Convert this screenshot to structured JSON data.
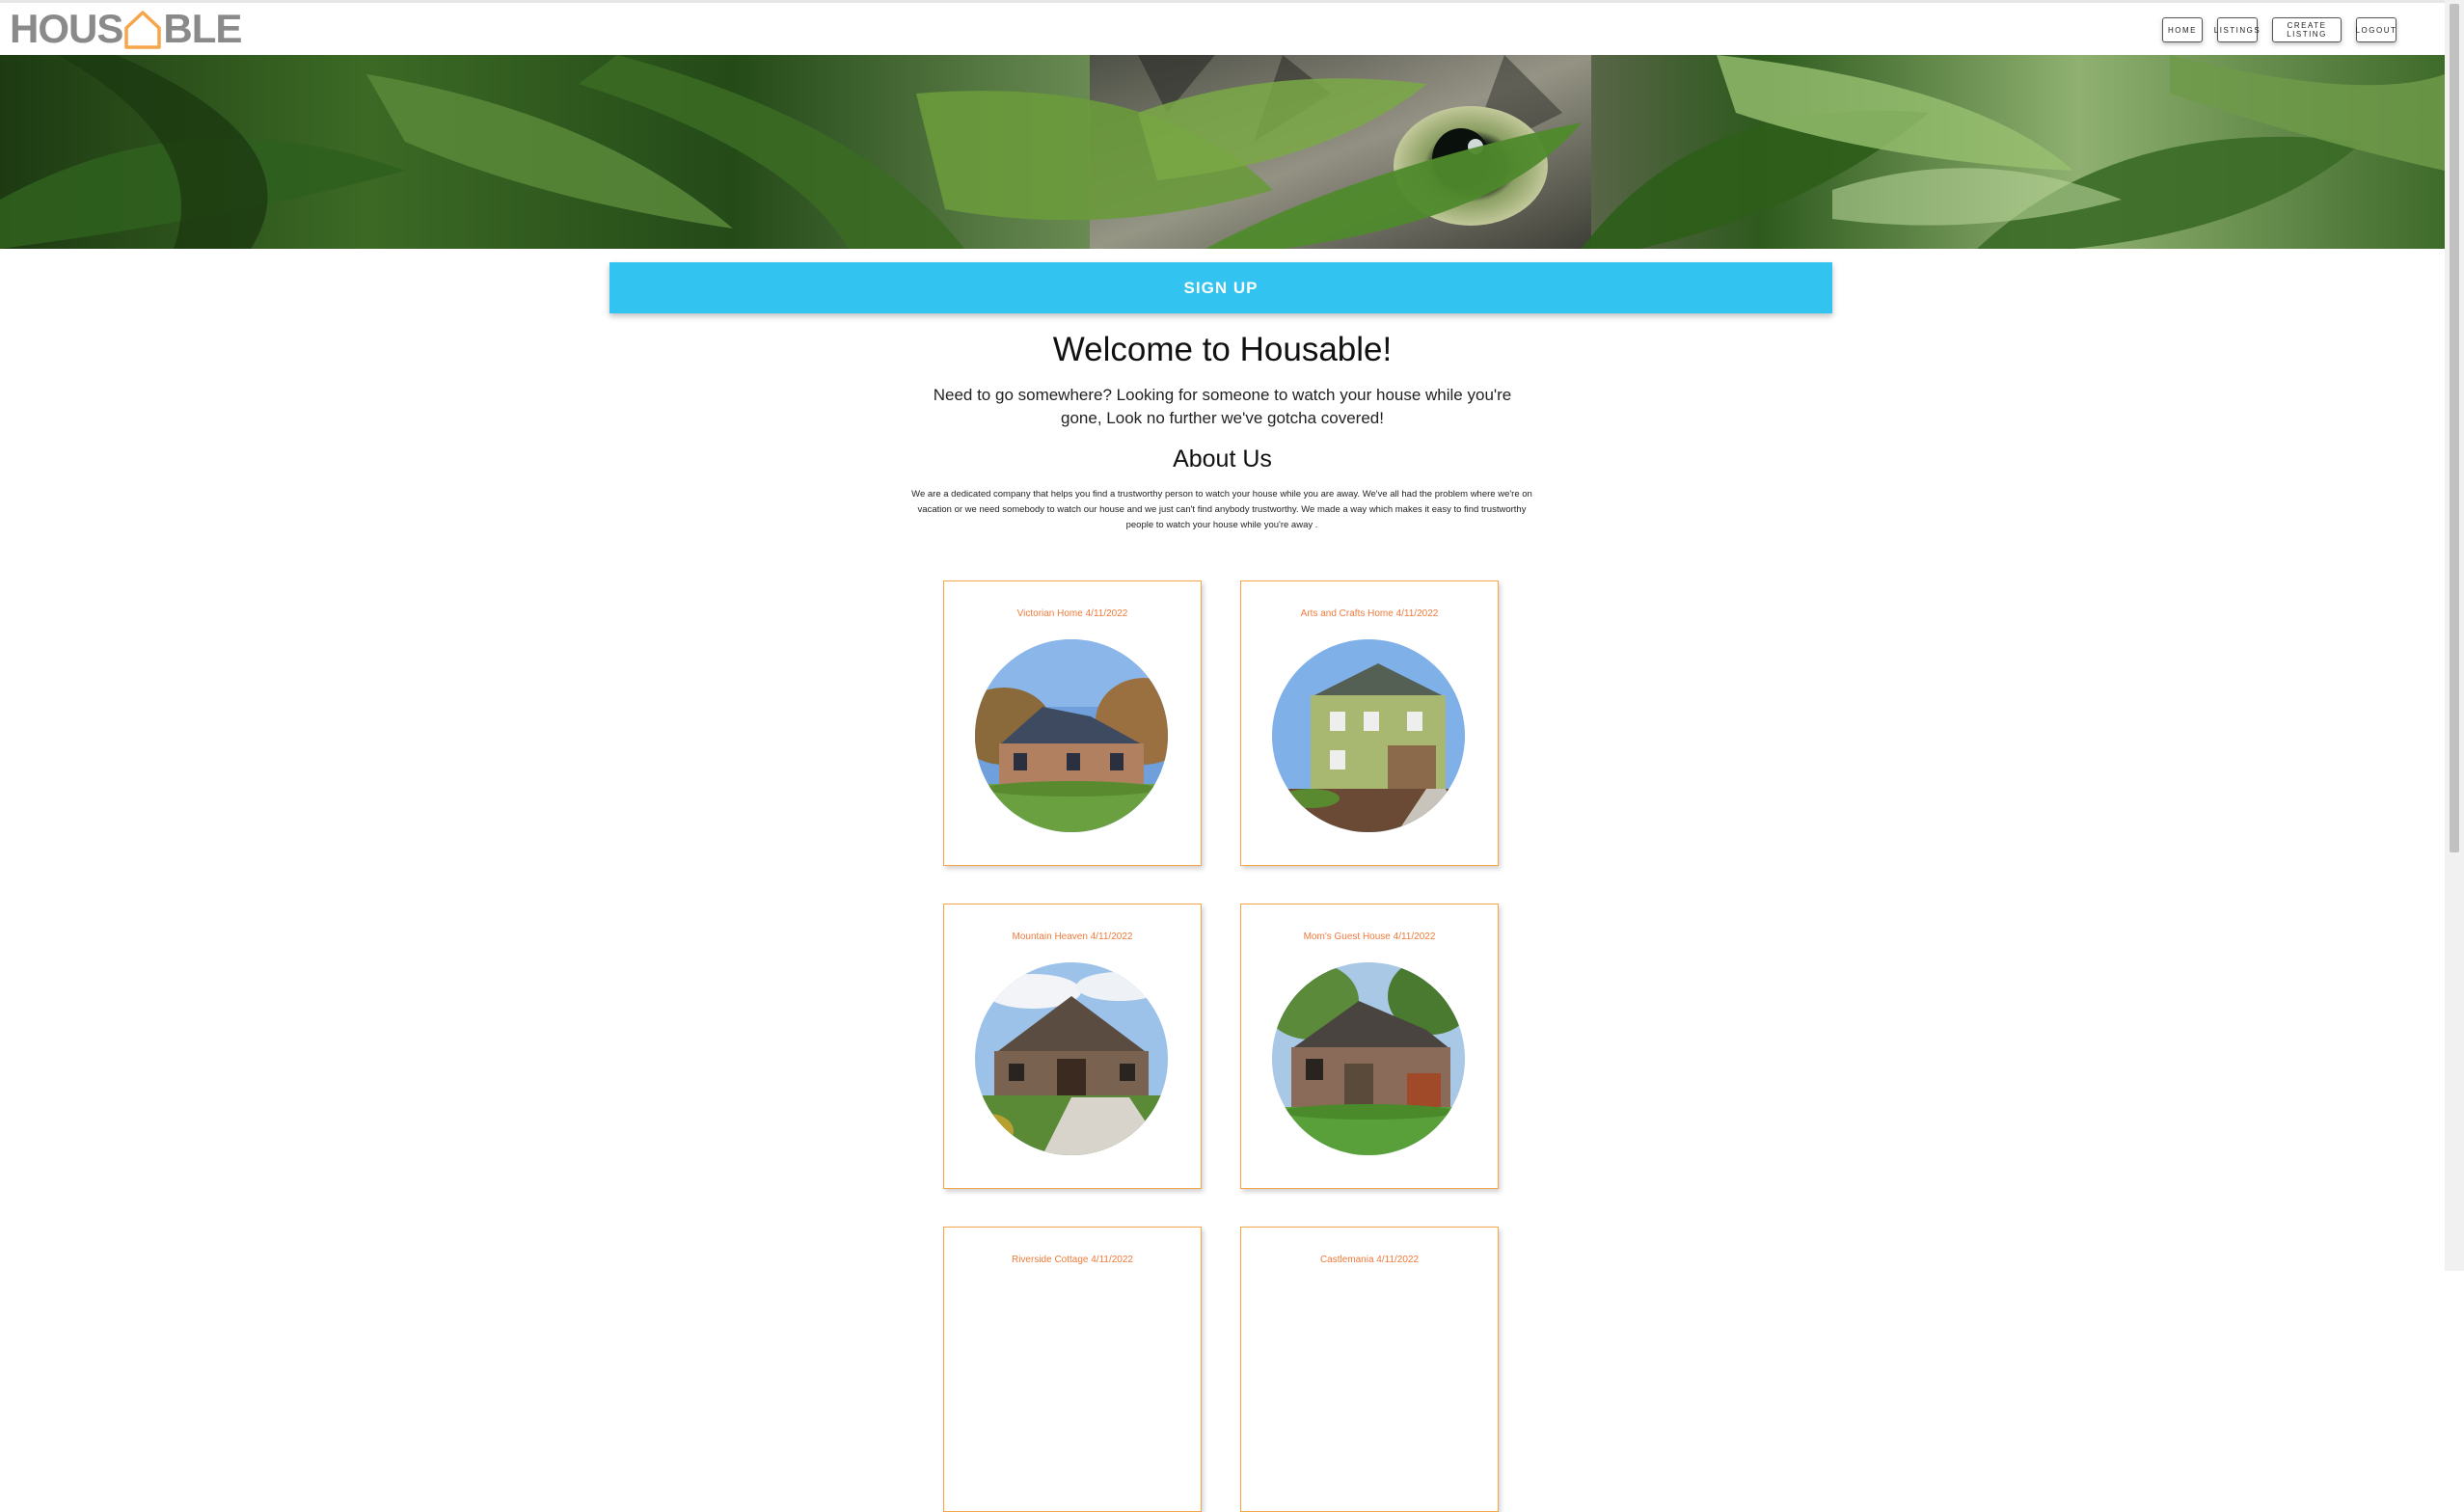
{
  "brand": {
    "logo_left": "HOUS",
    "logo_right": "BLE"
  },
  "nav": {
    "home": "HOME",
    "listings": "LISTINGS",
    "create_listing": "CREATE LISTING",
    "logout": "LOGOUT"
  },
  "hero": {
    "icon": "cat-in-leaves-banner"
  },
  "signup": {
    "label": "SIGN UP"
  },
  "welcome": {
    "title": "Welcome to Housable!",
    "intro": "Need to go somewhere? Looking for someone to watch your house while you're gone, Look no further we've gotcha covered!"
  },
  "about": {
    "title": "About Us",
    "text": "We are a dedicated company that helps you find a trustworthy person to watch your house while you are away. We've all had the problem where we're on vacation or we need somebody to watch our house and we just can't find anybody trustworthy. We made a way which makes it easy to find trustworthy people to watch your house while you're away ."
  },
  "listings": [
    {
      "title": "Victorian Home 4/11/2022"
    },
    {
      "title": "Arts and Crafts Home 4/11/2022"
    },
    {
      "title": "Mountain Heaven 4/11/2022"
    },
    {
      "title": "Mom's Guest House 4/11/2022"
    },
    {
      "title": "Riverside Cottage 4/11/2022"
    },
    {
      "title": "Castlemania 4/11/2022"
    }
  ],
  "colors": {
    "accent": "#33c3f0",
    "card_border": "#f5a54a",
    "card_title": "#f07a3a",
    "logo_gray": "#8a8a8a",
    "logo_orange": "#f5a54a"
  }
}
